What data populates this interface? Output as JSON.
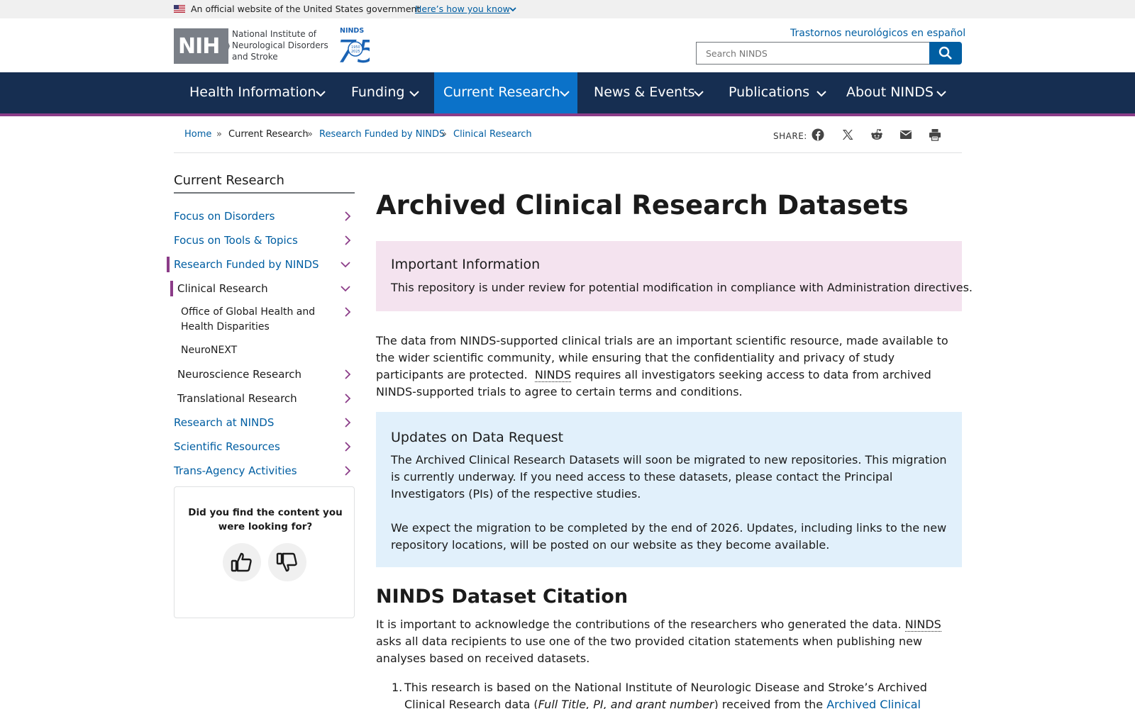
{
  "gov_banner": {
    "text": "An official website of the United States government",
    "link": "Here’s how you know"
  },
  "header": {
    "logo_text": "NIH",
    "institute_name": "National Institute of Neurological Disorders and Stroke",
    "anniversary": {
      "label": "NINDS",
      "years": "1950 2025",
      "number": "75"
    },
    "spanish_link": "Trastornos neurológicos en español",
    "search_placeholder": "Search NINDS"
  },
  "nav": {
    "items": [
      {
        "label": "Health Information",
        "active": false
      },
      {
        "label": "Funding",
        "active": false
      },
      {
        "label": "Current Research",
        "active": true
      },
      {
        "label": "News & Events",
        "active": false
      },
      {
        "label": "Publications",
        "active": false
      },
      {
        "label": "About NINDS",
        "active": false
      }
    ]
  },
  "breadcrumb": {
    "items": [
      "Home",
      "Current Research",
      "Research Funded by NINDS",
      "Clinical Research"
    ],
    "separator": "»"
  },
  "share": {
    "label": "SHARE:",
    "icons": [
      "facebook-icon",
      "x-icon",
      "reddit-icon",
      "email-icon",
      "print-icon"
    ]
  },
  "sidebar": {
    "title": "Current Research",
    "items": [
      {
        "label": "Focus on Disorders"
      },
      {
        "label": "Focus on Tools & Topics"
      },
      {
        "label": "Research Funded by NINDS"
      },
      {
        "label": "Clinical Research"
      },
      {
        "label": "Office of Global Health and Health Disparities"
      },
      {
        "label": "NeuroNEXT"
      },
      {
        "label": "Neuroscience Research"
      },
      {
        "label": "Translational Research"
      },
      {
        "label": "Research at NINDS"
      },
      {
        "label": "Scientific Resources"
      },
      {
        "label": "Trans-Agency Activities"
      }
    ],
    "feedback_question": "Did you find the content you were looking for?"
  },
  "main": {
    "title": "Archived Clinical Research Datasets",
    "important": {
      "title": "Important Information",
      "body": "This repository is under review for potential modification in compliance with Administration directives."
    },
    "intro": {
      "part1": "The data from NINDS-supported clinical trials are an important scientific resource, made available to the wider scientific community, while ensuring that the confidentiality and privacy of study participants are protected.",
      "abbr": "NINDS",
      "part2": "requires all investigators seeking access to data from archived NINDS-supported trials to agree to certain terms and conditions."
    },
    "updates": {
      "title": "Updates on Data Request",
      "para1": "The Archived Clinical Research Datasets will soon be migrated to new repositories. This migration is currently underway. If you need access to these datasets, please contact the Principal Investigators (PIs) of the respective studies.",
      "para2": "We expect the migration to be completed by the end of 2026. Updates, including links to the new repository locations, will be posted on our website as they become available."
    },
    "citation": {
      "title": "NINDS Dataset Citation",
      "part1": "It is important to acknowledge the contributions of the researchers who generated the data.",
      "abbr": "NINDS",
      "part2": "asks all data recipients to use one of the two provided citation statements when publishing new analyses based on received datasets.",
      "list_item": {
        "num": "1.",
        "text1": "This research is based on the National Institute of Neurologic Disease and Stroke’s Archived Clinical Research data (",
        "italic": "Full Title, PI, and grant number",
        "text2": ") received from the",
        "link": "Archived Clinical Research Dataset"
      }
    }
  },
  "colors": {
    "nav_bg": "#162e51",
    "nav_active": "#0b72c9",
    "accent_purple": "#8b3c88",
    "link_blue": "#005ea2",
    "pink_alert": "#f4e3ef",
    "blue_alert": "#e1f0fb"
  }
}
